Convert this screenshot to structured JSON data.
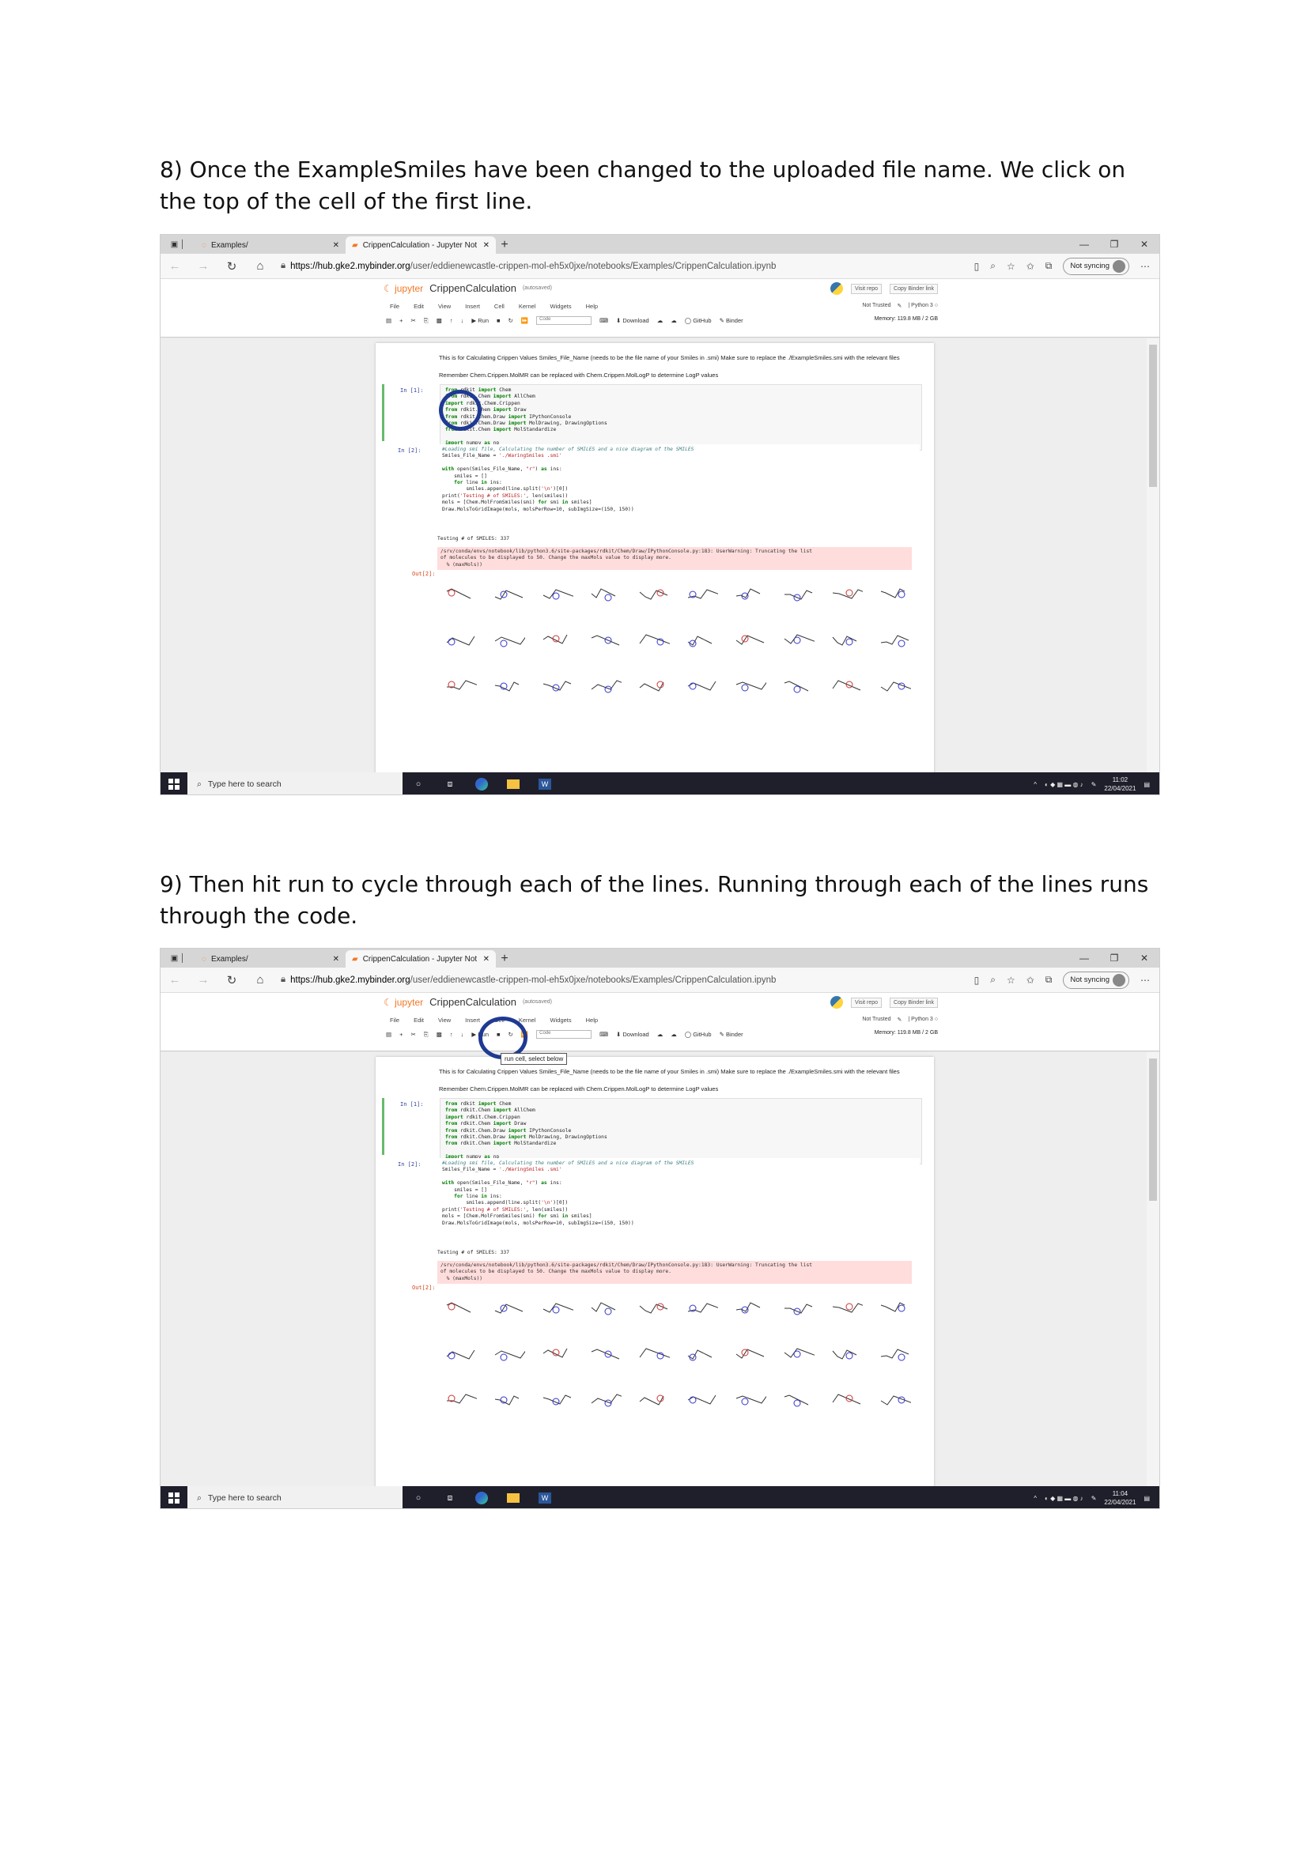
{
  "steps": [
    {
      "text": "8) Once the ExampleSmiles have been changed to the uploaded file name. We click on the top of the cell of the first line."
    },
    {
      "text": "9) Then hit run to cycle through each of the lines. Running through each of the lines runs through the code."
    }
  ],
  "browser": {
    "tab1": "Examples/",
    "tab2": "CrippenCalculation - Jupyter Not",
    "url_host": "https://hub.gke2.mybinder.org",
    "url_path": "/user/eddienewcastle-crippen-mol-eh5x0jxe/notebooks/Examples/CrippenCalculation.ipynb",
    "sync": "Not syncing"
  },
  "jupyter": {
    "logo": "jupyter",
    "notebook_name": "CrippenCalculation",
    "autosave": "(autosaved)",
    "visit_repo": "Visit repo",
    "copy_binder": "Copy Binder link",
    "menu": [
      "File",
      "Edit",
      "View",
      "Insert",
      "Cell",
      "Kernel",
      "Widgets",
      "Help"
    ],
    "not_trusted": "Not Trusted",
    "kernel": "Python 3",
    "run_label": "Run",
    "cell_type": "Code",
    "download": "Download",
    "github": "GitHub",
    "binder": "Binder",
    "memory": "Memory: 119.8 MB / 2 GB",
    "tooltip": "run cell, select below"
  },
  "notebook": {
    "md1": "This is for Calculating Crippen Values Smiles_File_Name (needs to be the file name of your Smiles in .smi) Make sure to replace the ./ExampleSmiles.smi with the relevant files",
    "md2": "Remember Chem.Crippen.MolMR can be replaced with Chem.Crippen.MolLogP to determine LogP values",
    "prompt1": "In [1]:",
    "prompt2": "In [2]:",
    "out_prompt": "Out[2]:",
    "testing": "Testing # of SMILES: 337",
    "warning": "/srv/conda/envs/notebook/lib/python3.6/site-packages/rdkit/Chem/Draw/IPythonConsole.py:183: UserWarning: Truncating the list\nof molecules to be displayed to 50. Change the maxMols value to display more.\n  % (maxMols))"
  },
  "taskbar": {
    "search": "Type here to search",
    "time1": "11:02",
    "time2": "11:04",
    "date": "22/04/2021"
  }
}
